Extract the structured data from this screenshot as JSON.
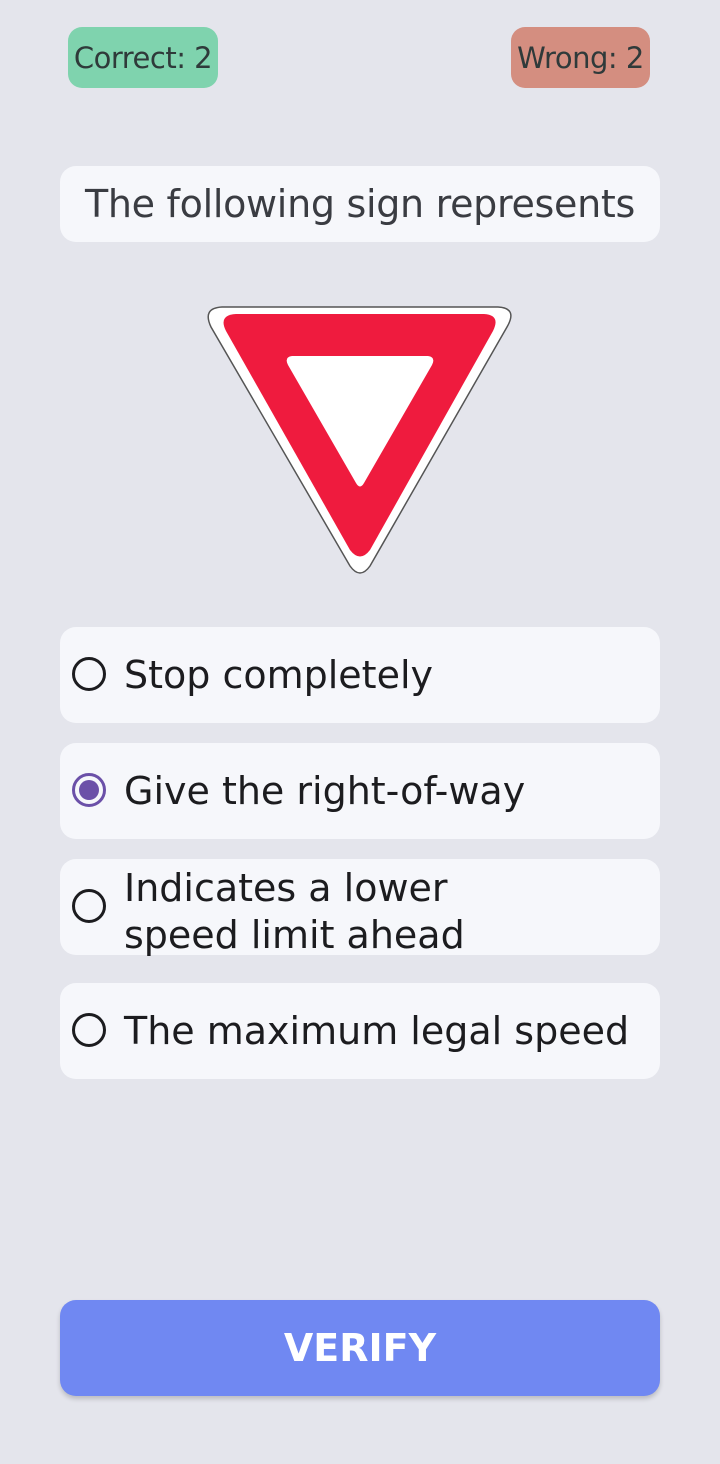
{
  "score": {
    "correct_label": "Correct: 2",
    "wrong_label": "Wrong: 2",
    "correct_color": "#7fd3ae",
    "wrong_color": "#d48e80"
  },
  "question": {
    "text": "The following sign represents"
  },
  "sign": {
    "icon": "yield-sign-icon",
    "color": "#ef1b3e"
  },
  "options": [
    {
      "label": "Stop completely",
      "selected": false
    },
    {
      "label": "Give the right-of-way",
      "selected": true
    },
    {
      "label": "Indicates a lower speed limit ahead",
      "selected": false
    },
    {
      "label": "The maximum legal speed",
      "selected": false
    }
  ],
  "verify_button": {
    "label": "VERIFY",
    "color": "#7088f2"
  }
}
